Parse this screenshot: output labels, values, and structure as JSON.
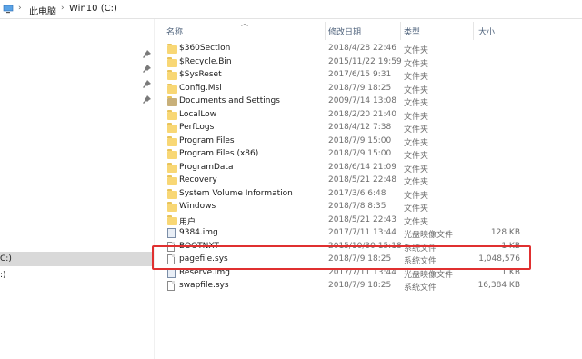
{
  "breadcrumb": {
    "icon": "computer-icon",
    "this_pc": "此电脑",
    "drive": "Win10 (C:)",
    "separator": "›"
  },
  "columns": {
    "name": "名称",
    "date": "修改日期",
    "type": "类型",
    "size": "大小"
  },
  "nav": {
    "selected_fragment": "C:)",
    "second_fragment": ":)"
  },
  "files": [
    {
      "name": "$360Section",
      "date": "2018/4/28 22:46",
      "type": "文件夹",
      "size": "",
      "icon": "folder-icon"
    },
    {
      "name": "$Recycle.Bin",
      "date": "2015/11/22 19:59",
      "type": "文件夹",
      "size": "",
      "icon": "folder-icon"
    },
    {
      "name": "$SysReset",
      "date": "2017/6/15 9:31",
      "type": "文件夹",
      "size": "",
      "icon": "folder-icon"
    },
    {
      "name": "Config.Msi",
      "date": "2018/7/9 18:25",
      "type": "文件夹",
      "size": "",
      "icon": "folder-icon"
    },
    {
      "name": "Documents and Settings",
      "date": "2009/7/14 13:08",
      "type": "文件夹",
      "size": "",
      "icon": "folder-shortcut-icon"
    },
    {
      "name": "LocalLow",
      "date": "2018/2/20 21:40",
      "type": "文件夹",
      "size": "",
      "icon": "folder-icon"
    },
    {
      "name": "PerfLogs",
      "date": "2018/4/12 7:38",
      "type": "文件夹",
      "size": "",
      "icon": "folder-icon"
    },
    {
      "name": "Program Files",
      "date": "2018/7/9 15:00",
      "type": "文件夹",
      "size": "",
      "icon": "folder-icon"
    },
    {
      "name": "Program Files (x86)",
      "date": "2018/7/9 15:00",
      "type": "文件夹",
      "size": "",
      "icon": "folder-icon"
    },
    {
      "name": "ProgramData",
      "date": "2018/6/14 21:09",
      "type": "文件夹",
      "size": "",
      "icon": "folder-icon"
    },
    {
      "name": "Recovery",
      "date": "2018/5/21 22:48",
      "type": "文件夹",
      "size": "",
      "icon": "folder-icon"
    },
    {
      "name": "System Volume Information",
      "date": "2017/3/6 6:48",
      "type": "文件夹",
      "size": "",
      "icon": "folder-icon"
    },
    {
      "name": "Windows",
      "date": "2018/7/8 8:35",
      "type": "文件夹",
      "size": "",
      "icon": "folder-icon"
    },
    {
      "name": "用户",
      "date": "2018/5/21 22:43",
      "type": "文件夹",
      "size": "",
      "icon": "folder-icon"
    },
    {
      "name": "9384.img",
      "date": "2017/7/11 13:44",
      "type": "光盘映像文件",
      "size": "128 KB",
      "icon": "disc-image-icon"
    },
    {
      "name": "BOOTNXT",
      "date": "2015/10/30 15:18",
      "type": "系统文件",
      "size": "1 KB",
      "icon": "file-icon"
    },
    {
      "name": "pagefile.sys",
      "date": "2018/7/9 18:25",
      "type": "系统文件",
      "size": "1,048,576",
      "icon": "file-icon"
    },
    {
      "name": "Reserve.img",
      "date": "2017/7/11 13:44",
      "type": "光盘映像文件",
      "size": "1 KB",
      "icon": "disc-image-icon"
    },
    {
      "name": "swapfile.sys",
      "date": "2018/7/9 18:25",
      "type": "系统文件",
      "size": "16,384 KB",
      "icon": "file-icon"
    }
  ],
  "highlight_color": "#e03030"
}
